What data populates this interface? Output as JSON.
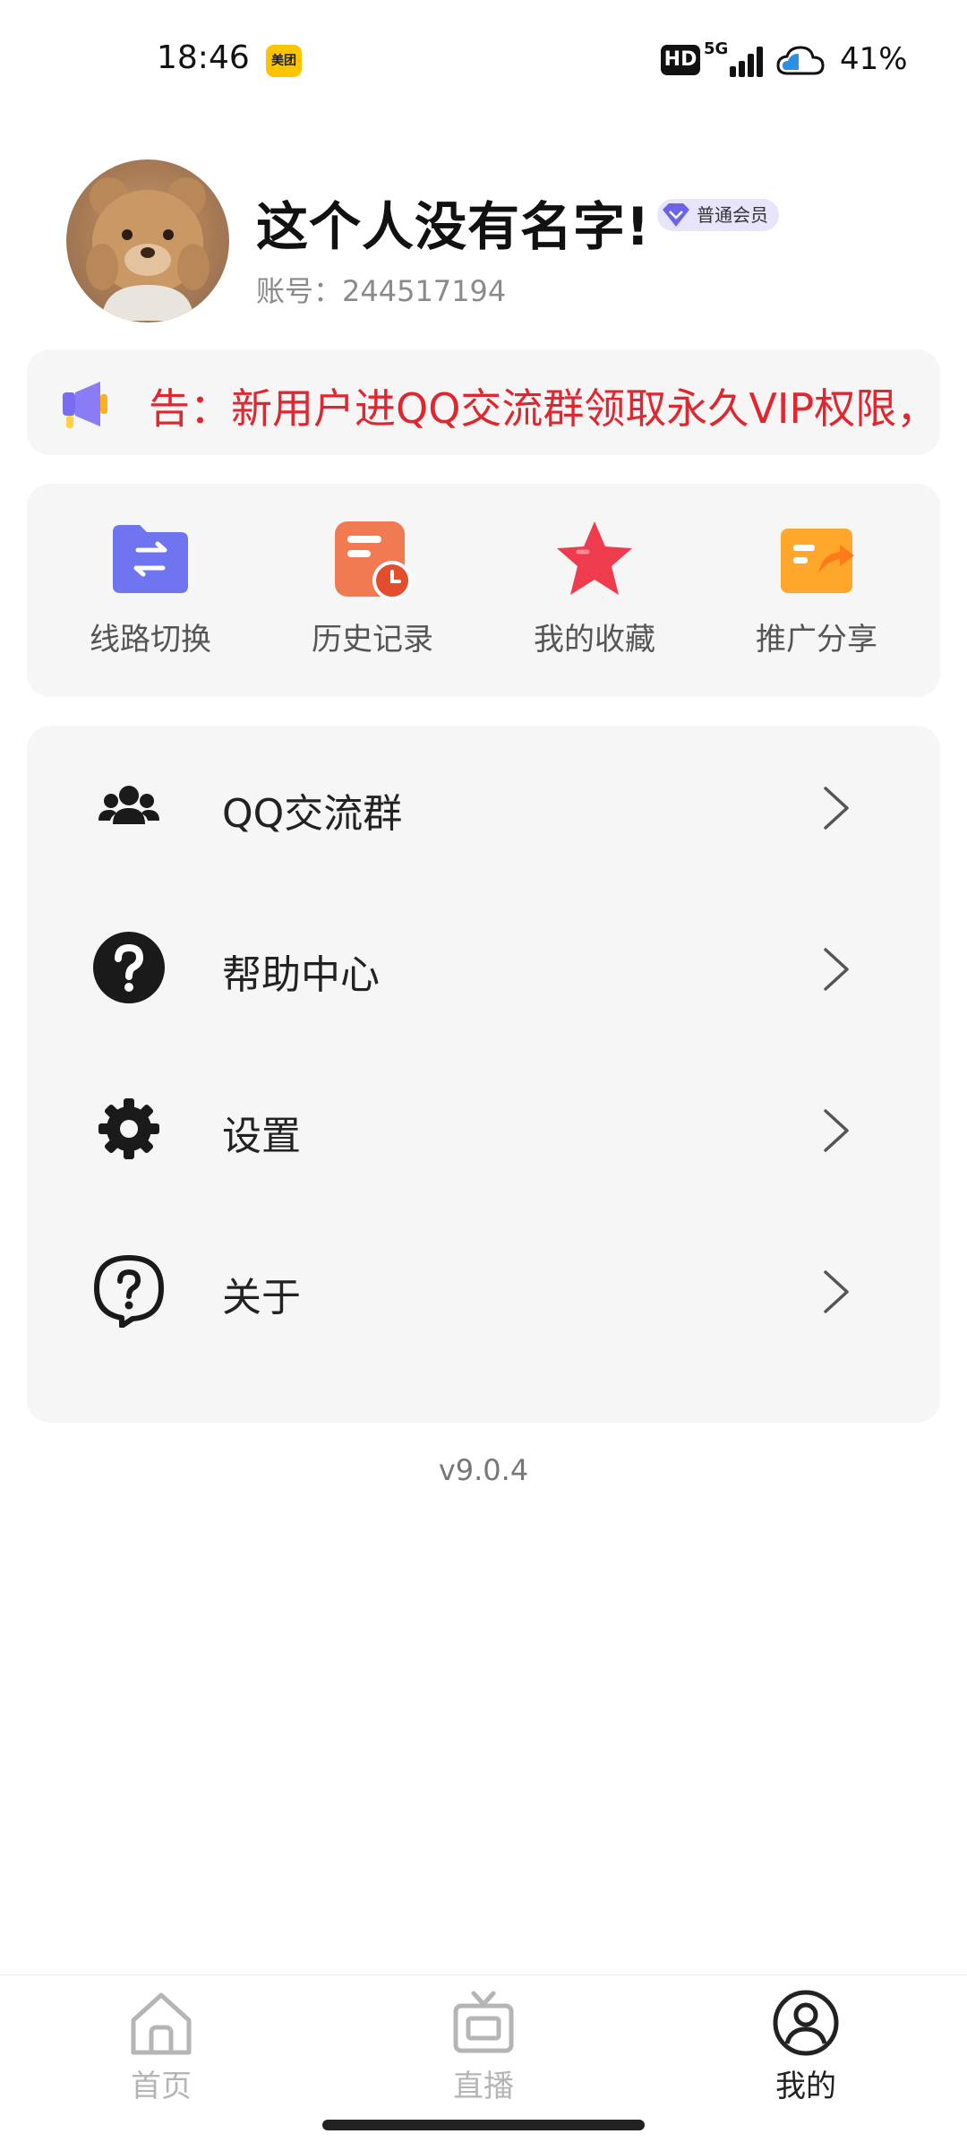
{
  "status_bar": {
    "time": "18:46",
    "app_badge": "美团",
    "hd": "HD",
    "network": "5G",
    "battery": "41%"
  },
  "profile": {
    "name": "这个人没有名字!",
    "badge": "普通会员",
    "account": "账号：244517194"
  },
  "notice": {
    "text": "告：新用户进QQ交流群领取永久VIP权限，"
  },
  "quick_actions": [
    {
      "label": "线路切换",
      "icon": "route-switch-icon"
    },
    {
      "label": "历史记录",
      "icon": "history-icon"
    },
    {
      "label": "我的收藏",
      "icon": "star-icon"
    },
    {
      "label": "推广分享",
      "icon": "share-icon"
    }
  ],
  "menu": [
    {
      "label": "QQ交流群",
      "icon": "users-icon"
    },
    {
      "label": "帮助中心",
      "icon": "help-circle-icon"
    },
    {
      "label": "设置",
      "icon": "gear-icon"
    },
    {
      "label": "关于",
      "icon": "question-bubble-icon"
    }
  ],
  "version": "v9.0.4",
  "bottom_nav": [
    {
      "label": "首页",
      "icon": "home-icon",
      "active": false
    },
    {
      "label": "直播",
      "icon": "tv-icon",
      "active": false
    },
    {
      "label": "我的",
      "icon": "profile-icon",
      "active": true
    }
  ],
  "colors": {
    "notice_text": "#e0262f",
    "active_tab": "#222222",
    "inactive_tab": "#b5b5b5",
    "card_bg": "#f6f6f6"
  }
}
